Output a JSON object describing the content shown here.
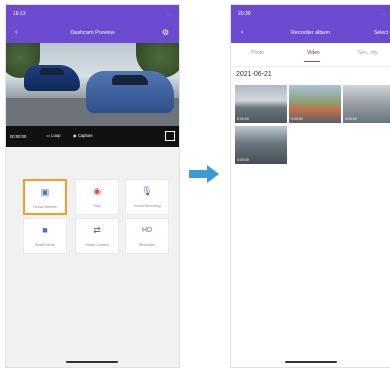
{
  "left_screen": {
    "status": {
      "time": "16:13",
      "right": "..."
    },
    "header": {
      "title": "Dashcam Preview"
    },
    "controls": {
      "timecode": "00:00:00",
      "loop_label": "Loop",
      "capture_label": "Capture"
    },
    "buttons": [
      {
        "label": "Device Albums",
        "icon": "albums-icon"
      },
      {
        "label": "Stop",
        "icon": "stop-icon"
      },
      {
        "label": "Sound Recording",
        "icon": "mic-icon"
      },
      {
        "label": "Switch Mode",
        "icon": "camera-icon"
      },
      {
        "label": "Switch Camera",
        "icon": "switch-camera-icon"
      },
      {
        "label": "Resolution",
        "icon": "hd-icon"
      }
    ]
  },
  "right_screen": {
    "status": {
      "time": "20:30",
      "right": "..."
    },
    "header": {
      "title": "Recorder album",
      "action": "Select"
    },
    "tabs": [
      {
        "label": "Photo"
      },
      {
        "label": "Video"
      },
      {
        "label": "Sec...rity"
      }
    ],
    "date_group": "2021-06-21",
    "thumbnails": [
      {
        "caption": "0:00:00"
      },
      {
        "caption": "0:00:00"
      },
      {
        "caption": "0:00:00"
      },
      {
        "caption": "0:00:00"
      }
    ]
  },
  "colors": {
    "header": "#6c4bd1",
    "highlight": "#f59d2a",
    "arrow": "#3d9ad4",
    "stop": "#e14a4a",
    "accent": "#5a6ad0"
  }
}
